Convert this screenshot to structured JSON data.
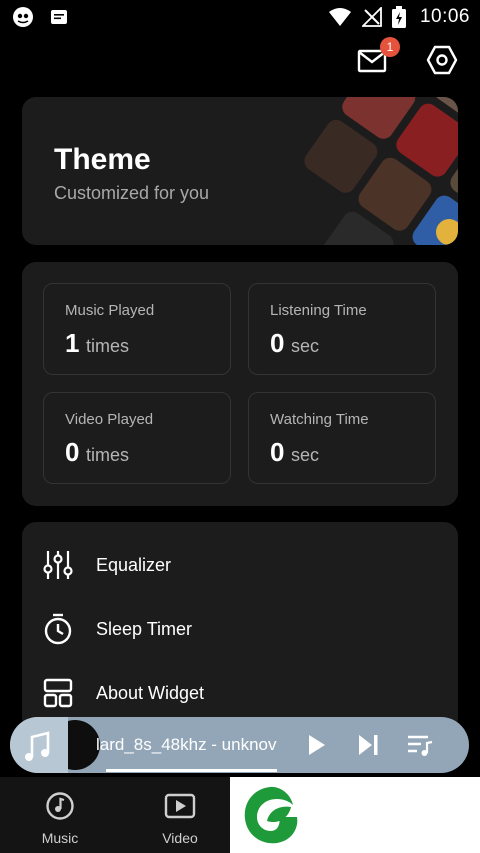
{
  "status_bar": {
    "time": "10:06",
    "left_icons": [
      "app-notification-icon",
      "message-notification-icon"
    ],
    "right_icons": [
      "wifi-icon",
      "signal-off-icon",
      "battery-charging-icon"
    ]
  },
  "header": {
    "mail_badge_count": "1",
    "icons": [
      "mail-icon",
      "settings-hexagon-icon"
    ]
  },
  "theme_card": {
    "title": "Theme",
    "subtitle": "Customized for you"
  },
  "stats": [
    {
      "label": "Music Played",
      "value": "1",
      "unit": "times"
    },
    {
      "label": "Listening Time",
      "value": "0",
      "unit": "sec"
    },
    {
      "label": "Video Played",
      "value": "0",
      "unit": "times"
    },
    {
      "label": "Watching Time",
      "value": "0",
      "unit": "sec"
    }
  ],
  "tools": [
    {
      "label": "Equalizer",
      "icon": "equalizer-icon"
    },
    {
      "label": "Sleep Timer",
      "icon": "timer-icon"
    },
    {
      "label": "About Widget",
      "icon": "widget-icon"
    }
  ],
  "player": {
    "track_title": "lard_8s_48khz - unknov",
    "progress": 0.45,
    "icons": [
      "music-note-icon",
      "play-icon",
      "next-icon",
      "playlist-icon"
    ]
  },
  "bottom_nav": [
    {
      "label": "Music",
      "icon": "music-disc-icon"
    },
    {
      "label": "Video",
      "icon": "video-play-icon"
    }
  ],
  "colors": {
    "background": "#000000",
    "card": "#1c1c1c",
    "player_bg": "#93a6b7",
    "badge": "#e5533c",
    "logo_green": "#1f9a3a"
  }
}
